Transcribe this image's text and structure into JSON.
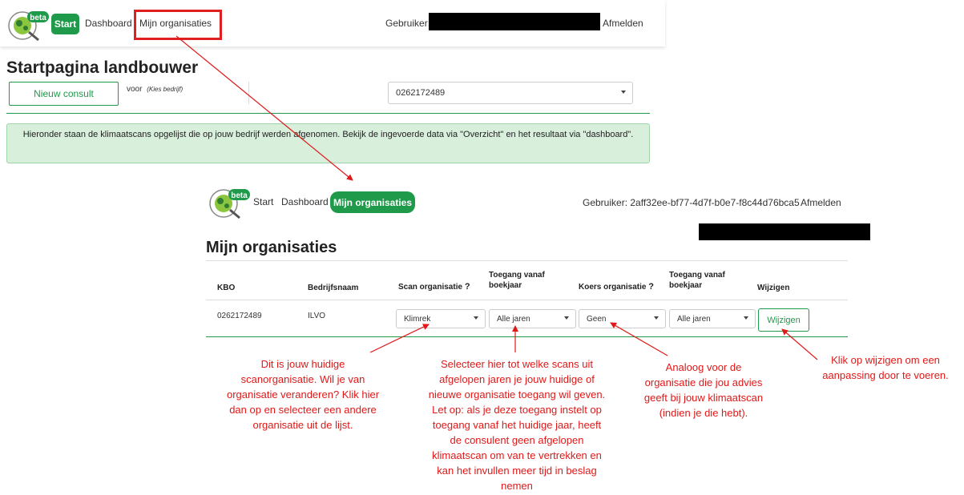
{
  "colors": {
    "brand": "#1f9a4a",
    "annotation": "#e01818",
    "info_bg": "#d8efdc"
  },
  "logo": {
    "badge": "beta",
    "icon": "klimrek-logo-icon"
  },
  "top": {
    "nav": {
      "start": "Start",
      "dashboard": "Dashboard",
      "orgs": "Mijn organisaties"
    },
    "user_label": "Gebruiker:",
    "logout": "Afmelden",
    "page_title": "Startpagina landbouwer",
    "new_consult": "Nieuw consult",
    "voor": "voor",
    "kies_bedrijf": "(Kies bedrijf)",
    "company_select": "0262172489",
    "info_text": "Hieronder staan de klimaatscans opgelijst die op jouw bedrijf werden afgenomen. Bekijk de ingevoerde data via \"Overzicht\" en het resultaat via \"dashboard\"."
  },
  "second": {
    "nav": {
      "start": "Start",
      "dashboard": "Dashboard",
      "orgs": "Mijn organisaties"
    },
    "user_label": "Gebruiker: 2aff32ee-bf77-4d7f-b0e7-f8c44d76bca5",
    "logout": "Afmelden",
    "page_title": "Mijn organisaties",
    "headers": {
      "kbo": "KBO",
      "name": "Bedrijfsnaam",
      "scan_org": "Scan organisatie",
      "access1_l1": "Toegang vanaf",
      "access1_l2": "boekjaar",
      "koers_org": "Koers organisatie",
      "access2_l1": "Toegang vanaf",
      "access2_l2": "boekjaar",
      "edit": "Wijzigen",
      "help": "?"
    },
    "row": {
      "kbo": "0262172489",
      "name": "ILVO",
      "scan_org": "Klimrek",
      "access1": "Alle jaren",
      "koers_org": "Geen",
      "access2": "Alle jaren",
      "edit_button": "Wijzigen"
    }
  },
  "annotations": {
    "a1": [
      "Dit is jouw huidige",
      "scanorganisatie. Wil je van",
      "organisatie veranderen? Klik hier",
      "dan op en selecteer een  andere",
      "organisatie uit de lijst."
    ],
    "a2": [
      "Selecteer hier tot welke scans uit",
      "afgelopen jaren je jouw huidige of",
      "nieuwe organisatie toegang wil geven.",
      "Let op: als je deze toegang instelt op",
      "toegang vanaf het huidige jaar, heeft",
      "de consulent geen afgelopen",
      "klimaatscan om van te vertrekken en",
      "kan het invullen meer tijd in beslag",
      "nemen"
    ],
    "a3": [
      "Analoog voor de",
      "organisatie die jou advies",
      "geeft bij jouw klimaatscan",
      "(indien je die hebt)."
    ],
    "a4": [
      "Klik op wijzigen om een",
      "aanpassing door te voeren."
    ]
  }
}
